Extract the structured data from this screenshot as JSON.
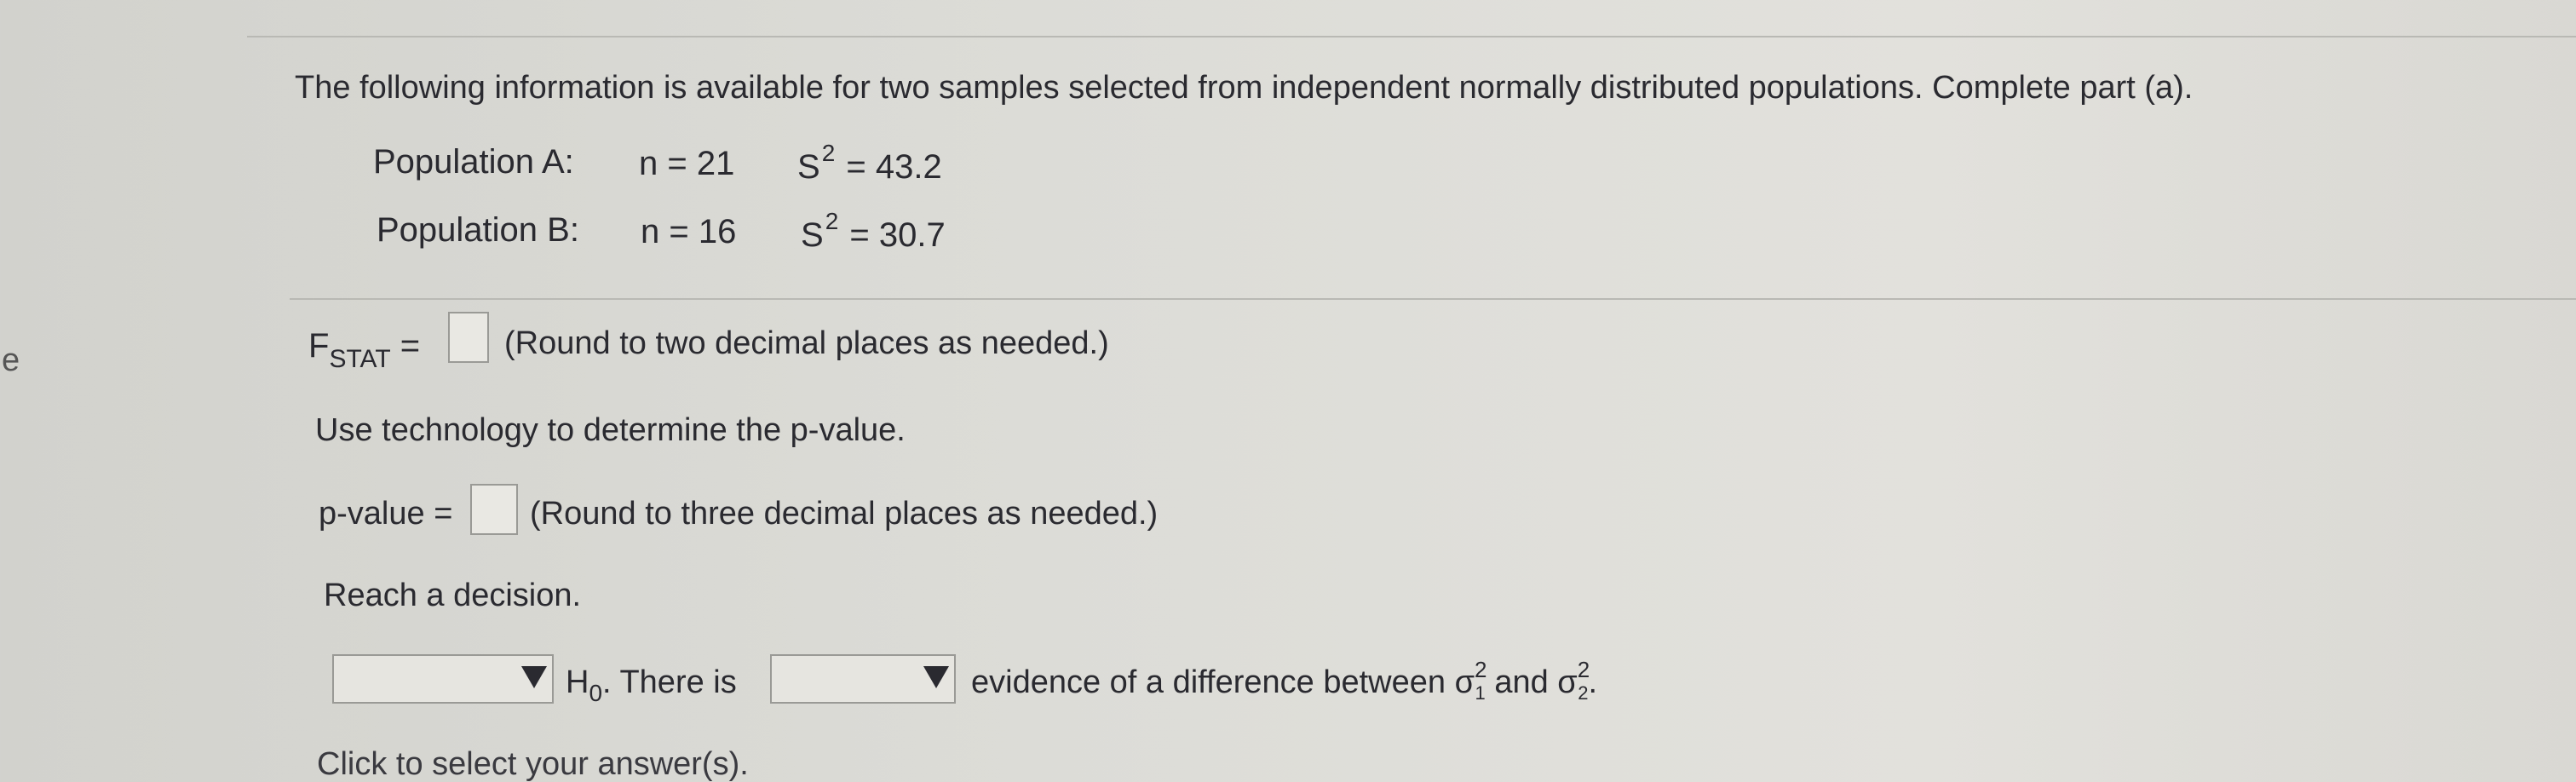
{
  "edge_letter": "e",
  "question": {
    "intro": "The following information is available for two samples selected from independent normally distributed populations. Complete part (a).",
    "population_a": {
      "label": "Population A:",
      "n": "n = 21",
      "s_prefix": "S",
      "s_exponent": "2",
      "s_value": " = 43.2"
    },
    "population_b": {
      "label": "Population B:",
      "n": "n = 16",
      "s_prefix": "S",
      "s_exponent": "2",
      "s_value": " = 30.7"
    }
  },
  "fstat": {
    "label_main": "F",
    "label_sub": "STAT",
    "equals": " = ",
    "input_value": "",
    "note": "(Round to two decimal places as needed.)"
  },
  "technology": {
    "instruction": "Use technology to determine the p-value."
  },
  "pvalue": {
    "label": "p-value = ",
    "input_value": "",
    "note": "(Round to three decimal places as needed.)"
  },
  "decision": {
    "heading": "Reach a decision.",
    "dropdown1_value": "",
    "h0_main": "H",
    "h0_sub": "0",
    "h0_rest": ". There is",
    "dropdown2_value": "",
    "evidence_text": "evidence of a difference between σ",
    "sigma1_sup": "2",
    "sigma1_sub": "1",
    "and_text": " and σ",
    "sigma2_sup": "2",
    "sigma2_sub": "2",
    "end": "."
  },
  "footer": {
    "click_select": "Click to select your answer(s)."
  },
  "colors": {
    "background": "#dcdcd7",
    "text": "#2a2a30",
    "input_border": "#9a9a96"
  }
}
